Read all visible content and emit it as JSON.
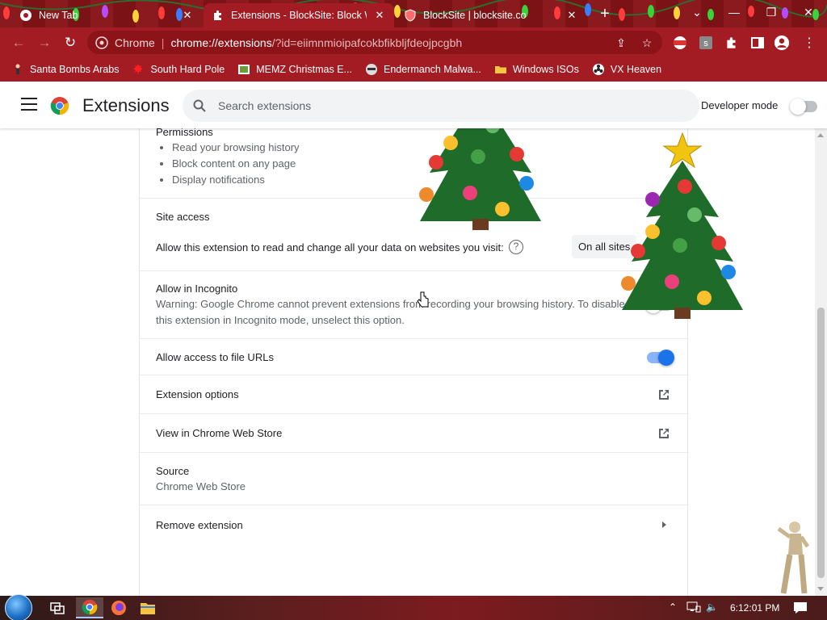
{
  "tabs": [
    {
      "title": "New Tab",
      "active": false
    },
    {
      "title": "Extensions - BlockSite: Block Web",
      "active": true
    },
    {
      "title": "BlockSite | blocksite.co",
      "active": false
    }
  ],
  "omnibox": {
    "site_label": "Chrome",
    "url_host": "chrome://extensions",
    "url_rest": "/?id=eiimnmioipafcokbfikbljfdeojpcgbh"
  },
  "bookmarks": [
    {
      "label": "Santa Bombs Arabs",
      "icon": "figure-icon"
    },
    {
      "label": "South Hard Pole",
      "icon": "maple-leaf-icon"
    },
    {
      "label": "MEMZ Christmas E...",
      "icon": "image-icon"
    },
    {
      "label": "Endermanch Malwa...",
      "icon": "raccoon-icon"
    },
    {
      "label": "Windows ISOs",
      "icon": "folder-icon"
    },
    {
      "label": "VX Heaven",
      "icon": "biohazard-icon"
    }
  ],
  "header": {
    "title": "Extensions",
    "search_placeholder": "Search extensions",
    "developer_mode_label": "Developer mode",
    "developer_mode_on": false
  },
  "details": {
    "permissions": {
      "heading": "Permissions",
      "items": [
        "Read your browsing history",
        "Block content on any page",
        "Display notifications"
      ]
    },
    "site_access": {
      "heading": "Site access",
      "description": "Allow this extension to read and change all your data on websites you visit:",
      "help": "?",
      "value": "On all sites"
    },
    "incognito": {
      "heading": "Allow in Incognito",
      "warning_line1": "Warning: Google Chrome cannot prevent extensions from recording your browsing history. To disable",
      "warning_line2": "this extension in Incognito mode, unselect this option.",
      "enabled": false
    },
    "file_urls": {
      "label": "Allow access to file URLs",
      "enabled": true
    },
    "extension_options": "Extension options",
    "web_store": "View in Chrome Web Store",
    "source": {
      "heading": "Source",
      "value": "Chrome Web Store"
    },
    "remove": "Remove extension"
  },
  "taskbar": {
    "time": "6:12:01 PM"
  },
  "colors": {
    "frame": "#a31b23",
    "tabstrip": "#8a1a1e",
    "accent": "#1a73e8"
  }
}
